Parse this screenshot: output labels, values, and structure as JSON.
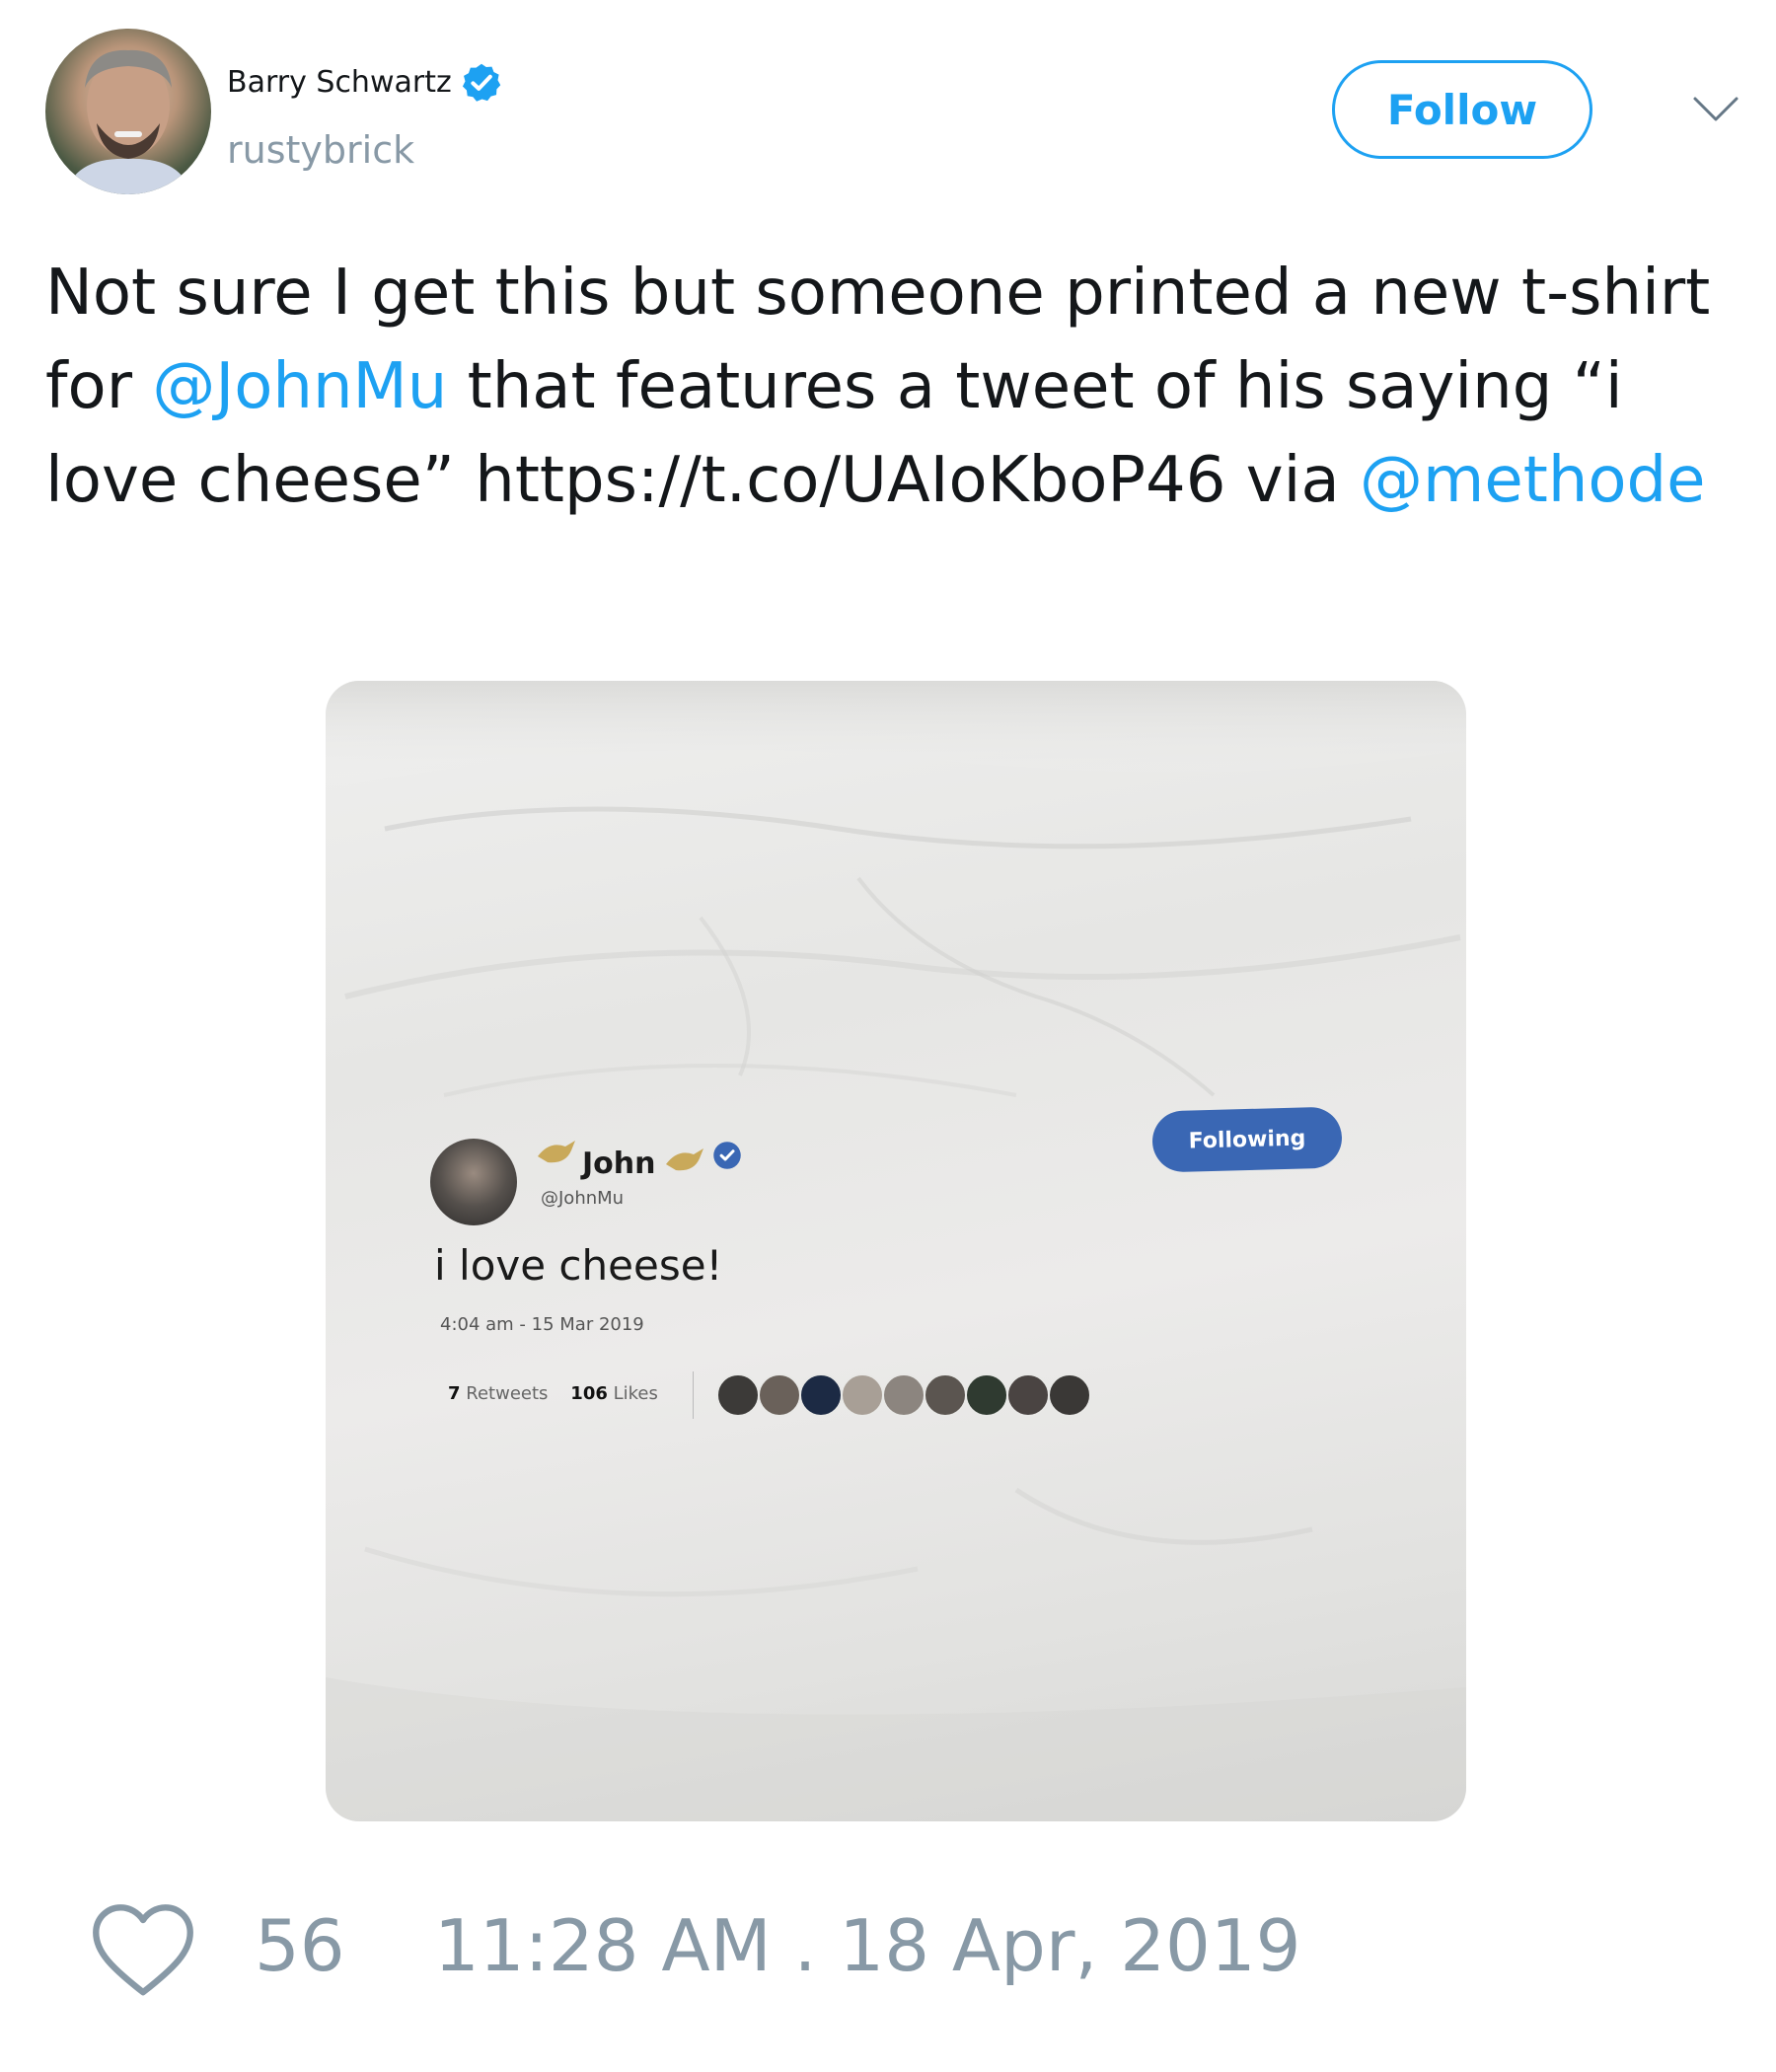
{
  "author": {
    "name": "Barry Schwartz",
    "handle": "rustybrick",
    "verified": true,
    "avatar_icon": "author-avatar"
  },
  "actions": {
    "follow_label": "Follow",
    "more_icon": "chevron-down-icon"
  },
  "tweet": {
    "text_before_mention1": "Not sure I get this but someone printed a new t-shirt for ",
    "mention1": "@JohnMu",
    "text_between": " that features a tweet of his saying “i love cheese” https://t.co/UAIoKboP46 via ",
    "mention2": "@methode"
  },
  "media": {
    "embedded_tweet": {
      "name": "John",
      "handle": "@JohnMu",
      "following_label": "Following",
      "text": "i love cheese!",
      "time": "4:04 am - 15 Mar 2019",
      "retweets_count": "7",
      "retweets_label": "Retweets",
      "likes_count": "106",
      "likes_label": "Likes"
    }
  },
  "footer": {
    "like_icon": "heart-icon",
    "like_count": "56",
    "timestamp": "11:28 AM . 18 Apr, 2019"
  },
  "colors": {
    "accent": "#1da1f2",
    "muted": "#8899a6",
    "text": "#14171a",
    "embedded_following": "#3a67b4"
  }
}
